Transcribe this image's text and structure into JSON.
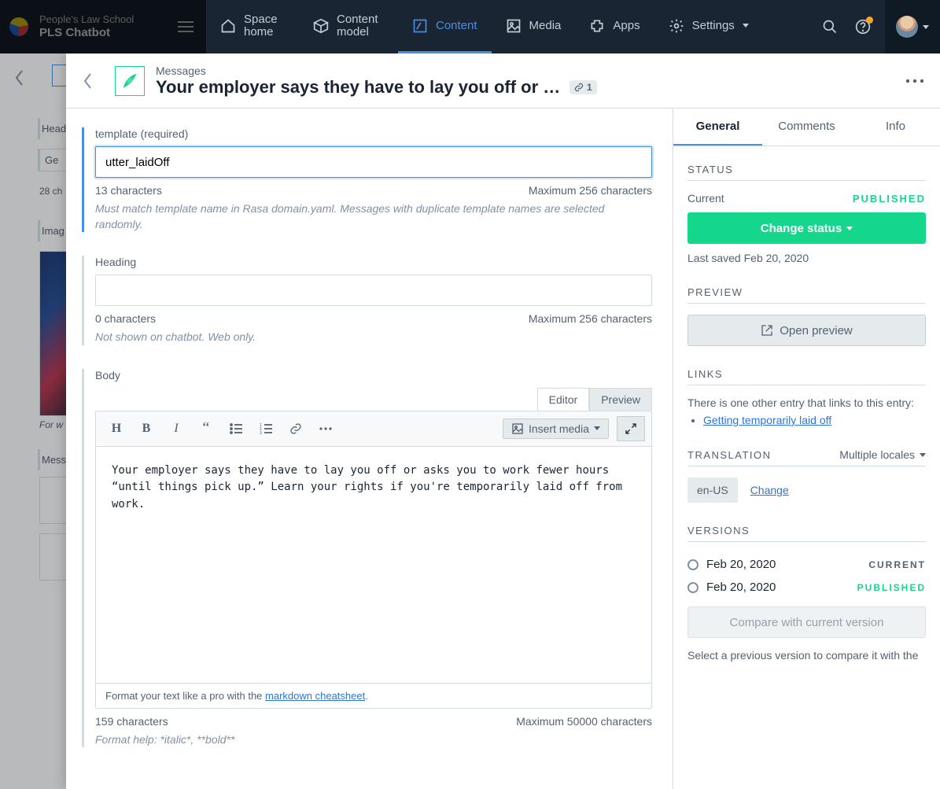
{
  "space": {
    "org": "People's Law School",
    "name": "PLS Chatbot"
  },
  "nav": {
    "space_home": "Space home",
    "content_model": "Content model",
    "content": "Content",
    "media": "Media",
    "apps": "Apps",
    "settings": "Settings"
  },
  "under": {
    "heading": "Head",
    "get": "Ge",
    "chars": "28 ch",
    "image": "Imag",
    "caption": "For w",
    "mess": "Mess"
  },
  "entry": {
    "type": "Messages",
    "title": "Your employer says they have to lay you off or ask…",
    "link_count": "1"
  },
  "fields": {
    "template": {
      "label": "template (required)",
      "value": "utter_laidOff",
      "count": "13 characters",
      "max": "Maximum 256 characters",
      "help": "Must match template name in Rasa domain.yaml. Messages with duplicate template names are selected randomly."
    },
    "heading": {
      "label": "Heading",
      "value": "",
      "count": "0 characters",
      "max": "Maximum 256 characters",
      "help": "Not shown on chatbot. Web only."
    },
    "body": {
      "label": "Body",
      "tab_editor": "Editor",
      "tab_preview": "Preview",
      "insert_media": "Insert media",
      "content": "Your employer says they have to lay you off or asks you to work fewer hours “until things pick up.” Learn your rights if you're temporarily laid off from work.",
      "footer_prefix": "Format your text like a pro with the ",
      "footer_link": "markdown cheatsheet",
      "count": "159 characters",
      "max": "Maximum 50000 characters",
      "help": "Format help: *italic*, **bold**"
    }
  },
  "sidebar": {
    "tabs": {
      "general": "General",
      "comments": "Comments",
      "info": "Info"
    },
    "status_heading": "STATUS",
    "current_label": "Current",
    "published": "PUBLISHED",
    "change_status": "Change status",
    "last_saved": "Last saved Feb 20, 2020",
    "preview_heading": "PREVIEW",
    "open_preview": "Open preview",
    "links_heading": "LINKS",
    "links_text": "There is one other entry that links to this entry:",
    "link_item": "Getting temporarily laid off",
    "translation_heading": "TRANSLATION",
    "multiple_locales": "Multiple locales",
    "locale": "en-US",
    "change": "Change",
    "versions_heading": "VERSIONS",
    "versions": [
      {
        "date": "Feb 20, 2020",
        "status": "CURRENT",
        "cls": "ver-status-cur"
      },
      {
        "date": "Feb 20, 2020",
        "status": "PUBLISHED",
        "cls": "ver-status-pub"
      }
    ],
    "compare": "Compare with current version",
    "compare_help": "Select a previous version to compare it with the"
  }
}
